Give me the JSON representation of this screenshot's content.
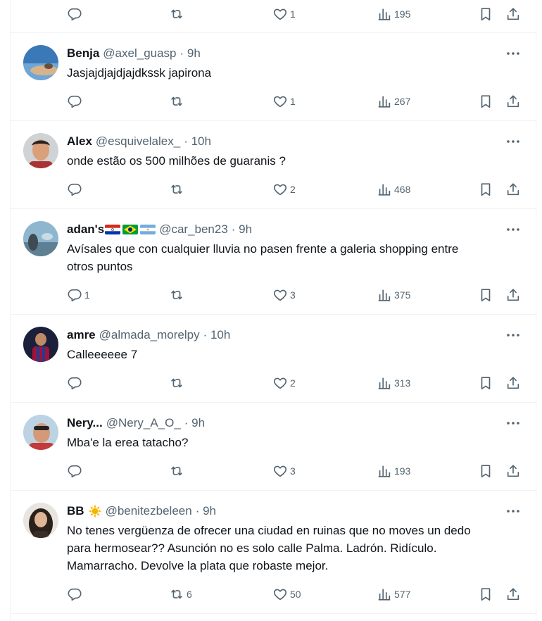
{
  "top_bar": {
    "views": "195"
  },
  "tweets": [
    {
      "name": "Benja",
      "handle": "@axel_guasp",
      "time": "· 9h",
      "text_lines": [
        "Jasjajdjajdjajdkssk japirona"
      ],
      "replies": "",
      "retweets": "",
      "likes": "1",
      "views": "267"
    },
    {
      "name": "Alex",
      "handle": "@esquivelalex_",
      "time": "· 10h",
      "text_lines": [
        "onde estão os 500 milhões de guaranis ?"
      ],
      "replies": "",
      "retweets": "",
      "likes": "2",
      "views": "468"
    },
    {
      "name": "adan's",
      "flags": [
        "paraguay-flag",
        "brazil-flag",
        "argentina-flag"
      ],
      "handle": "@car_ben23",
      "time": "· 9h",
      "text_lines": [
        "Avísales que con cualquier lluvia no pasen frente a galeria shopping entre",
        "otros puntos"
      ],
      "replies": "1",
      "retweets": "",
      "likes": "3",
      "views": "375"
    },
    {
      "name": "amre",
      "handle": "@almada_morelpy",
      "time": "· 10h",
      "text_lines": [
        "Calleeeeee 7"
      ],
      "replies": "",
      "retweets": "",
      "likes": "2",
      "views": "313"
    },
    {
      "name": "Nery...",
      "handle": "@Nery_A_O_",
      "time": "· 9h",
      "text_lines": [
        "Mba'e la erea tatacho?"
      ],
      "replies": "",
      "retweets": "",
      "likes": "3",
      "views": "193"
    },
    {
      "name": "BB",
      "badge": "sun-emoji",
      "handle": "@benitezbeleen",
      "time": "· 9h",
      "text_lines": [
        "No tenes vergüenza de ofrecer una ciudad en ruinas que no moves un dedo",
        "para hermosear?? Asunción no es solo calle Palma. Ladrón. Ridículo.",
        "Mamarracho. Devolve la plata que robaste mejor."
      ],
      "replies": "",
      "retweets": "6",
      "likes": "50",
      "views": "577"
    }
  ],
  "colors": {
    "text": "#0f1419",
    "secondary": "#536471",
    "border": "#eff3f4"
  }
}
